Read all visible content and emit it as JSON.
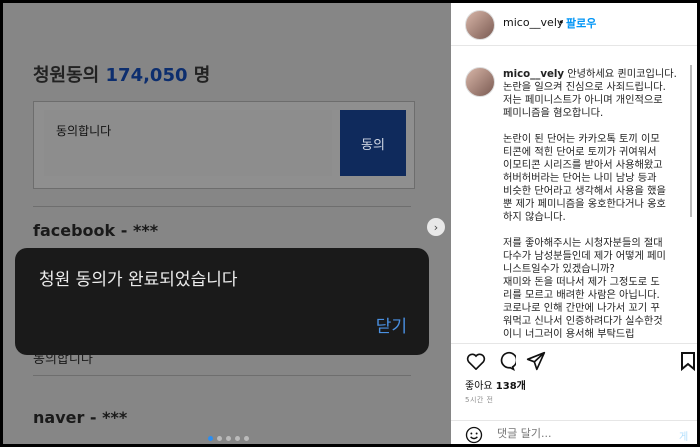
{
  "petition": {
    "title_prefix": "청원동의 ",
    "count": "174,050",
    "title_suffix": " 명",
    "agree_text": "동의합니다",
    "agree_button": "동의"
  },
  "comments": [
    {
      "author": "facebook - ***",
      "text": "동의합니다"
    },
    {
      "author": "naver - ***",
      "text": ""
    }
  ],
  "toast": {
    "message": "청원 동의가 완료되었습니다",
    "close_label": "닫기"
  },
  "carousel": {
    "next": "›",
    "page_count": 5,
    "active_index": 0
  },
  "post": {
    "username": "mico__vely",
    "follow_label": "팔로우",
    "follow_separator": "•",
    "caption_user": "mico__vely",
    "caption_lines": [
      " 안녕하세요 퀸미코입니다.",
      "논란을 일으켜 진심으로 사죄드립니다.",
      "저는 페미니스트가 아니며 개인적으로",
      "페미니즘을 혐오합니다.",
      "",
      "논란이 된 단어는 카카오톡 토끼 이모",
      "티콘에 적힌 단어로 토끼가 귀여워서",
      "이모티콘 시리즈를 받아서 사용해왔고",
      "허버허버라는 단어는 나미 남낭 등과",
      "비슷한 단어라고 생각해서 사용을 했을",
      "뿐 제가 페미니즘을 옹호한다거나 옹호",
      "하지 않습니다.",
      "",
      "저를 좋아해주시는 시청자분들의 절대",
      "다수가 남성분들인데 제가 어떻게 페미",
      "니스트일수가 있겠습니까?",
      "재미와 돈을 떠나서 제가 그정도로 도",
      "리를 모르고 배려한 사람은 아닙니다.",
      "코로나로 인해 간만에 나가서 꼬기 꾸",
      "워먹고 신나서 인증하려다가 실수한것",
      "이니 너그러이 용서해 부탁드립"
    ],
    "likes_label": "좋아요 ",
    "likes_count": "138개",
    "time": "5시간 전",
    "comment_placeholder": "댓글 달기...",
    "post_label": "게시"
  }
}
